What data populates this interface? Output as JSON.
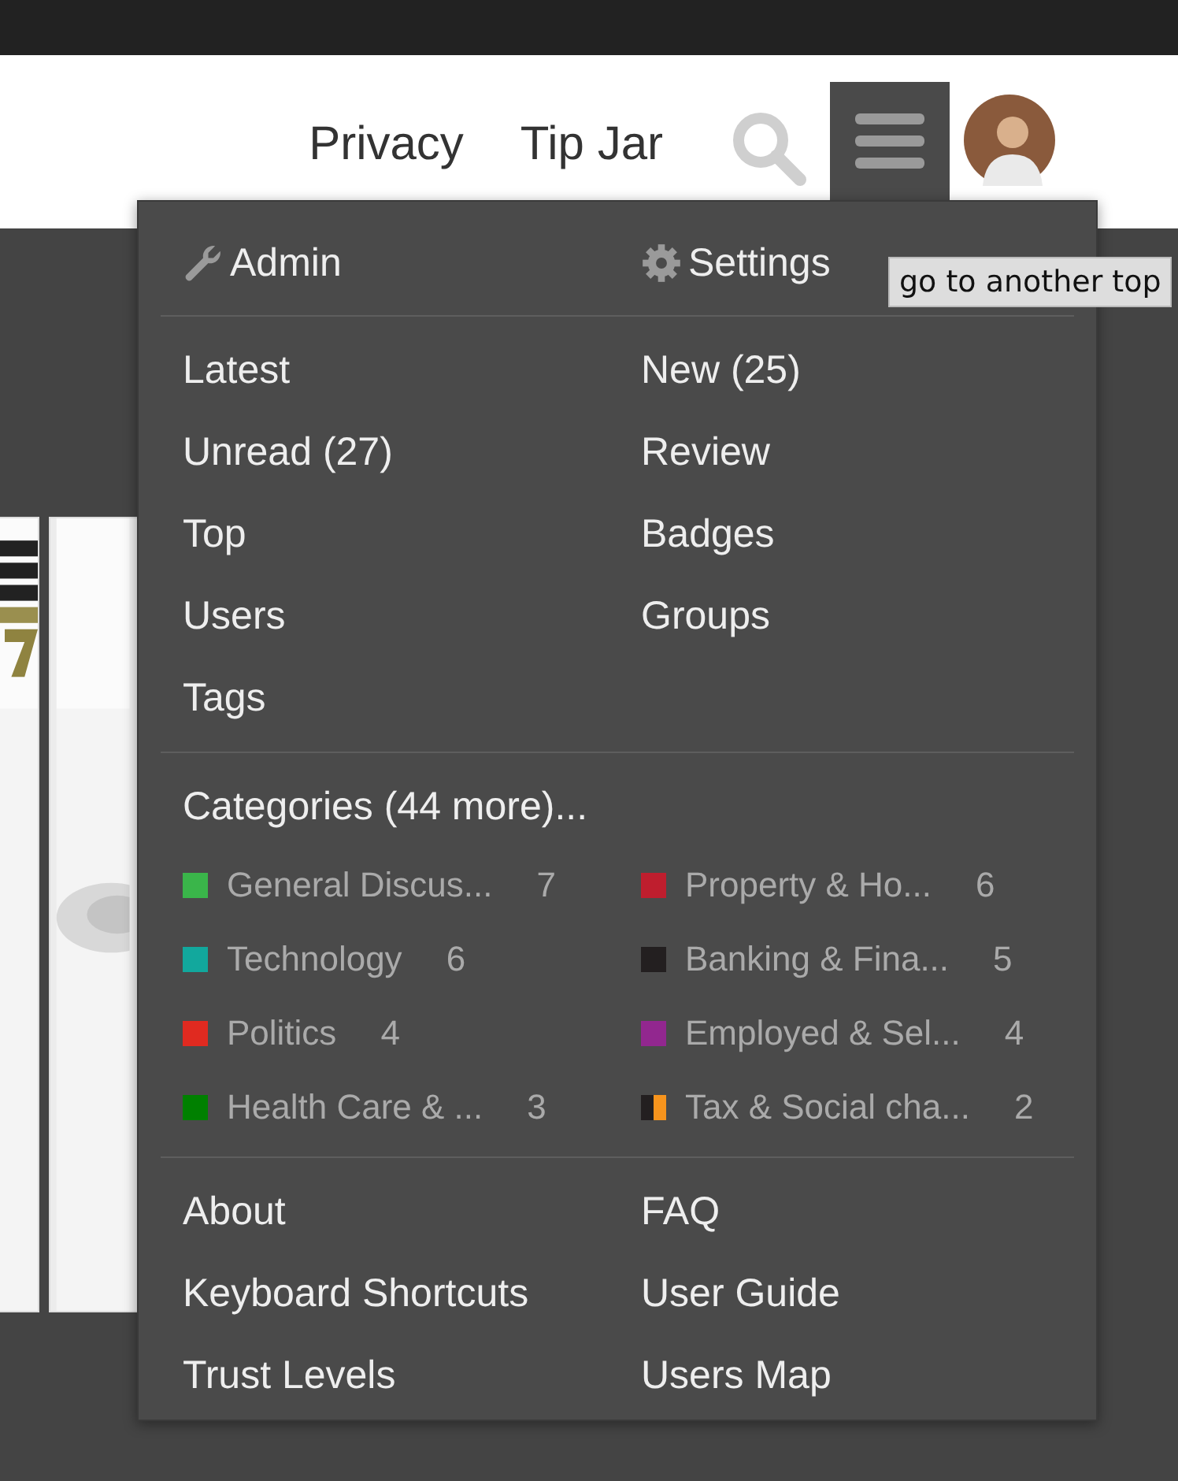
{
  "header": {
    "links": [
      {
        "label": "Privacy"
      },
      {
        "label": "Tip Jar"
      }
    ],
    "menu_expanded": true
  },
  "menu": {
    "admin": {
      "label": "Admin"
    },
    "settings": {
      "label": "Settings"
    },
    "links": [
      {
        "label": "Latest"
      },
      {
        "label": "New (25)"
      },
      {
        "label": "Unread (27)"
      },
      {
        "label": "Review"
      },
      {
        "label": "Top"
      },
      {
        "label": "Badges"
      },
      {
        "label": "Users"
      },
      {
        "label": "Groups"
      },
      {
        "label": "Tags"
      }
    ],
    "categories_heading": "Categories (44 more)...",
    "categories": [
      {
        "name": "General Discus...",
        "count": "7",
        "swatches": [
          {
            "color": "#3ab54a"
          }
        ]
      },
      {
        "name": "Property & Ho...",
        "count": "6",
        "swatches": [
          {
            "color": "#bf1e2e"
          }
        ]
      },
      {
        "name": "Technology",
        "count": "6",
        "swatches": [
          {
            "color": "#12a89d"
          }
        ]
      },
      {
        "name": "Banking & Fina...",
        "count": "5",
        "swatches": [
          {
            "color": "#231f20"
          }
        ]
      },
      {
        "name": "Politics",
        "count": "4",
        "swatches": [
          {
            "color": "#e02a20"
          }
        ]
      },
      {
        "name": "Employed & Sel...",
        "count": "4",
        "swatches": [
          {
            "color": "#92278f"
          }
        ]
      },
      {
        "name": "Health Care & ...",
        "count": "3",
        "swatches": [
          {
            "color": "#008000"
          }
        ]
      },
      {
        "name": "Tax & Social cha...",
        "count": "2",
        "swatches": [
          {
            "color": "#231f20"
          },
          {
            "color": "#f7941d"
          }
        ]
      }
    ],
    "footer_links": [
      {
        "label": "About"
      },
      {
        "label": "FAQ"
      },
      {
        "label": "Keyboard Shortcuts"
      },
      {
        "label": "User Guide"
      },
      {
        "label": "Trust Levels"
      },
      {
        "label": "Users Map"
      }
    ]
  },
  "tooltip": "go to another top"
}
